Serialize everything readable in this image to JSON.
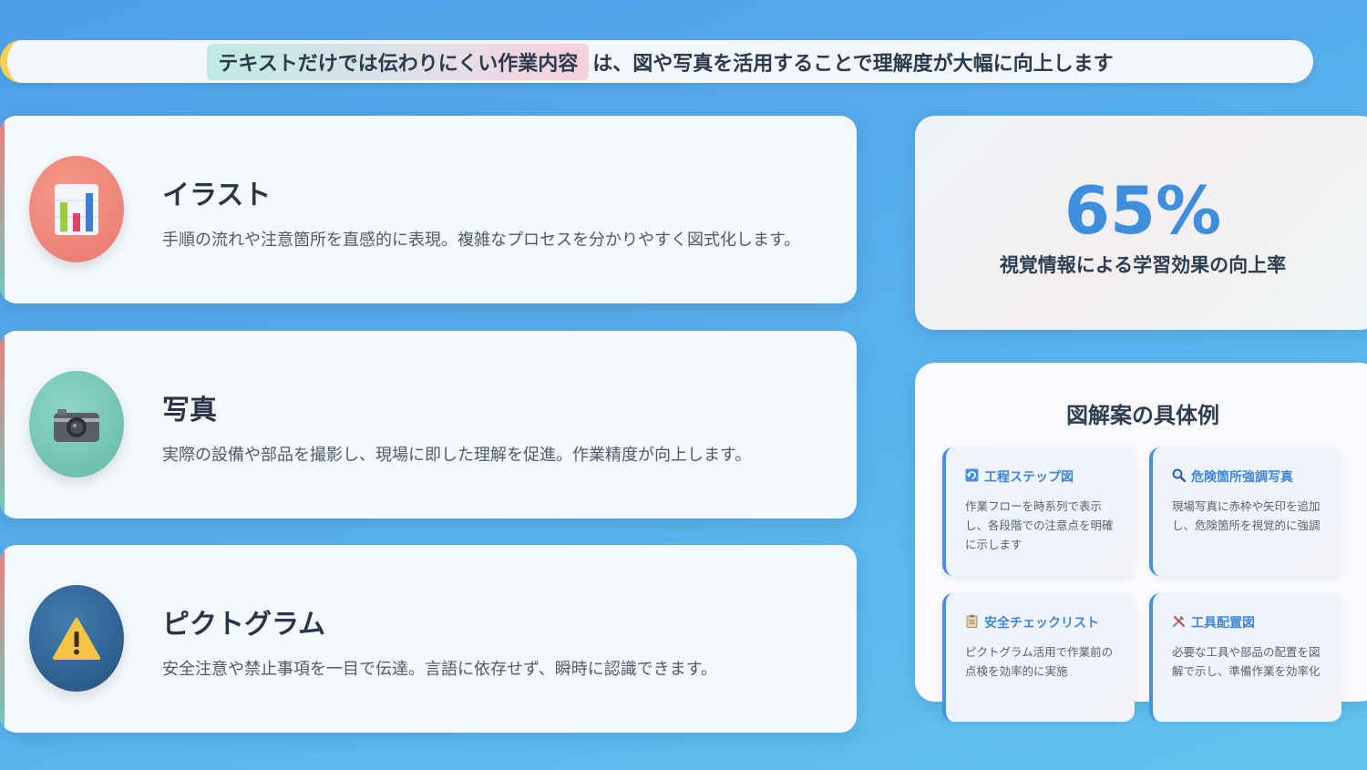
{
  "banner": {
    "highlight": "テキストだけでは伝わりにくい作業内容",
    "rest": "は、図や写真を活用することで理解度が大幅に向上します"
  },
  "cards": [
    {
      "icon": "bar-chart-icon",
      "title": "イラスト",
      "desc": "手順の流れや注意箇所を直感的に表現。複雑なプロセスを分かりやすく図式化します。"
    },
    {
      "icon": "camera-icon",
      "title": "写真",
      "desc": "実際の設備や部品を撮影し、現場に即した理解を促進。作業精度が向上します。"
    },
    {
      "icon": "warning-icon",
      "title": "ピクトグラム",
      "desc": "安全注意や禁止事項を一目で伝達。言語に依存せず、瞬時に認識できます。"
    }
  ],
  "stat": {
    "value": "65%",
    "label": "視覚情報による学習効果の向上率"
  },
  "examples": {
    "heading": "図解案の具体例",
    "items": [
      {
        "icon": "refresh-icon",
        "title": "工程ステップ図",
        "text": "作業フローを時系列で表示し、各段階での注意点を明確に示します"
      },
      {
        "icon": "magnifier-icon",
        "title": "危険箇所強調写真",
        "text": "現場写真に赤枠や矢印を追加し、危険箇所を視覚的に強調"
      },
      {
        "icon": "clipboard-icon",
        "title": "安全チェックリスト",
        "text": "ピクトグラム活用で作業前の点検を効率的に実施"
      },
      {
        "icon": "tools-icon",
        "title": "工具配置図",
        "text": "必要な工具や部品の配置を図解で示し、準備作業を効率化"
      }
    ]
  },
  "colors": {
    "accent": "#3d8fdd",
    "background": "#58b0ec"
  }
}
